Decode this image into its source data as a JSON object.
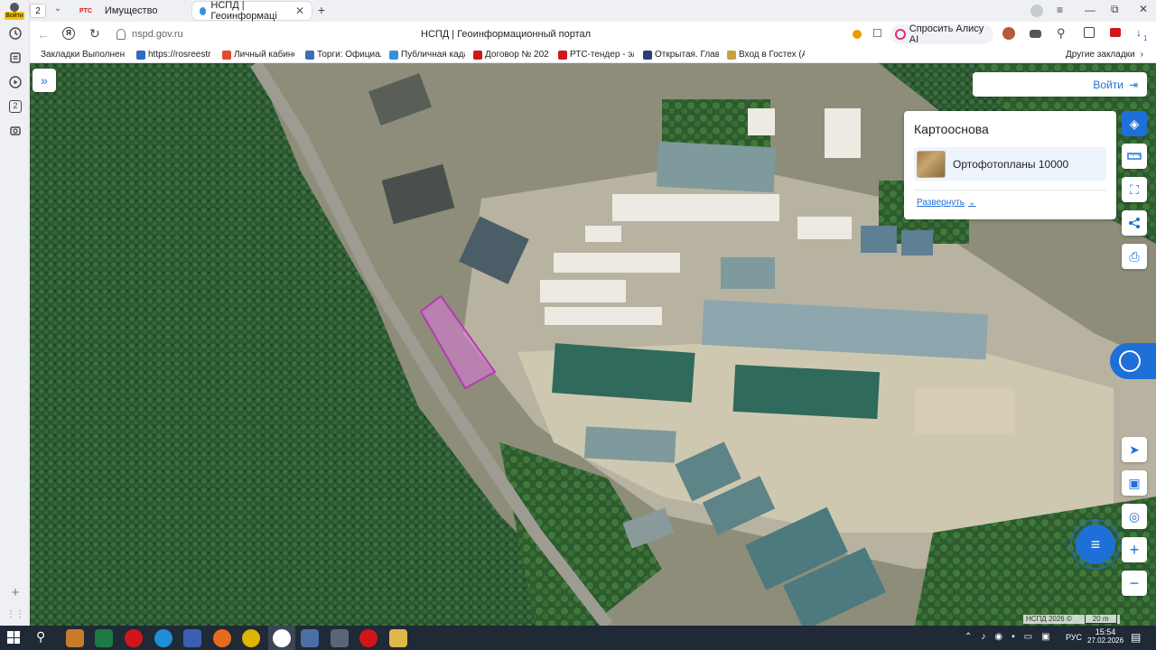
{
  "browser": {
    "profile_label": "Войти",
    "tab_count": "2",
    "tabs": [
      {
        "favicon_text": "РТС",
        "label": "Имущество"
      },
      {
        "label": "НСПД | Геоинформаці"
      }
    ],
    "address": "nspd.gov.ru",
    "page_title": "НСПД | Геоинформационный портал",
    "alice_label": "Спросить Алису AI",
    "downloads_count": "1",
    "bookmarks": [
      "Закладки Выполнен",
      "https://rosreestr.r",
      "Личный кабинет",
      "Торги: Официаль",
      "Публичная кадас",
      "Договор № 2023..",
      "РТС-тендер - элек",
      "Открытая. Главна",
      "Вход в Гостех (Ау"
    ],
    "bookmarks_other": "Другие закладки",
    "sidebar_counter": "2"
  },
  "map": {
    "login_label": "Войти",
    "basemap_panel": {
      "title": "Картооснова",
      "layer_name": "Ортофотопланы 10000",
      "expand_label": "Развернуть"
    },
    "attribution": "НСПД 2026 ©",
    "scale_label": "20 m"
  },
  "taskbar": {
    "lang": "РУС",
    "time": "15:54",
    "date": "27.02.2026"
  }
}
